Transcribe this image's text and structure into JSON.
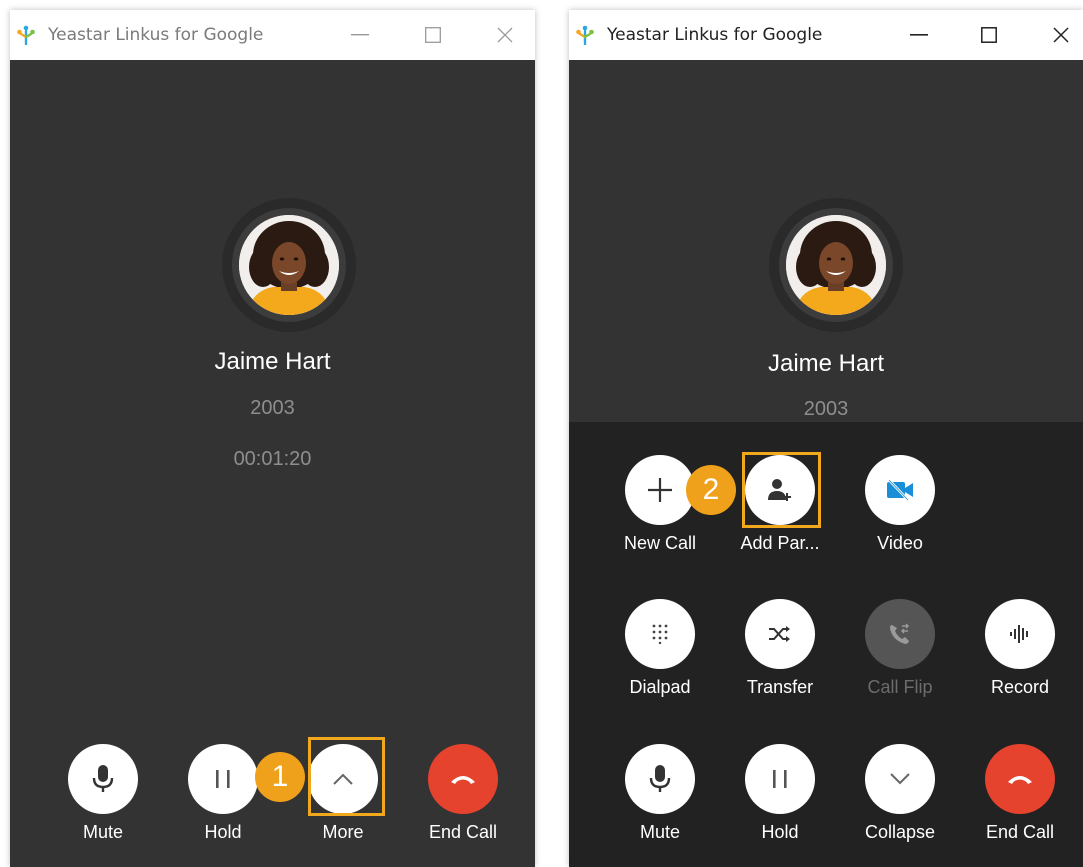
{
  "left_window": {
    "title": "Yeastar Linkus for Google",
    "contact": {
      "name": "Jaime Hart",
      "number": "2003",
      "duration": "00:01:20"
    },
    "buttons": {
      "mute": "Mute",
      "hold": "Hold",
      "more": "More",
      "end_call": "End Call"
    },
    "step_badge": "1"
  },
  "right_window": {
    "title": "Yeastar Linkus for Google",
    "contact": {
      "name": "Jaime Hart",
      "number": "2003"
    },
    "buttons": {
      "new_call": "New Call",
      "add_participant": "Add Par...",
      "video": "Video",
      "dialpad": "Dialpad",
      "transfer": "Transfer",
      "call_flip": "Call Flip",
      "record": "Record",
      "mute": "Mute",
      "hold": "Hold",
      "collapse": "Collapse",
      "end_call": "End Call"
    },
    "step_badge": "2"
  },
  "colors": {
    "end_call": "#e5432e",
    "highlight": "#f2a81d",
    "badge": "#f0a11c",
    "video_icon": "#1a8fd8"
  }
}
